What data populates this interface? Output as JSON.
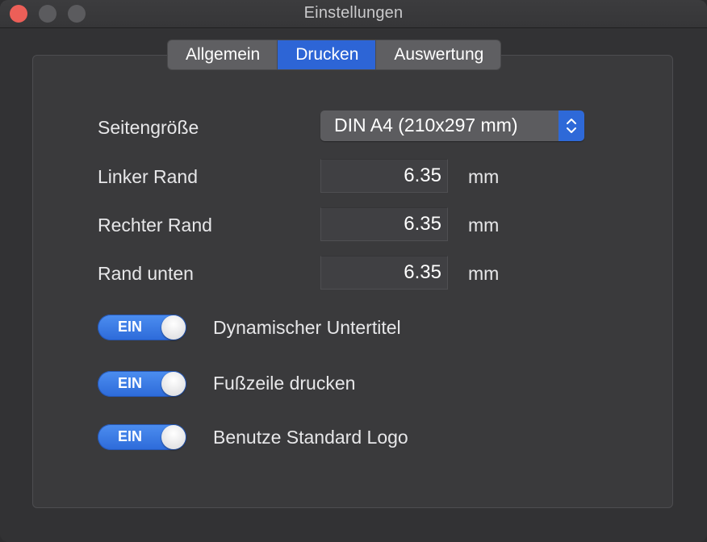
{
  "window": {
    "title": "Einstellungen"
  },
  "tabs": [
    {
      "label": "Allgemein",
      "active": false
    },
    {
      "label": "Drucken",
      "active": true
    },
    {
      "label": "Auswertung",
      "active": false
    }
  ],
  "page_size": {
    "label": "Seitengröße",
    "value": "DIN A4 (210x297 mm)"
  },
  "margins": [
    {
      "label": "Linker Rand",
      "value": "6.35",
      "unit": "mm"
    },
    {
      "label": "Rechter Rand",
      "value": "6.35",
      "unit": "mm"
    },
    {
      "label": "Rand unten",
      "value": "6.35",
      "unit": "mm"
    }
  ],
  "toggles": [
    {
      "state_label": "EIN",
      "label": "Dynamischer Untertitel",
      "on": true
    },
    {
      "state_label": "EIN",
      "label": "Fußzeile drucken",
      "on": true
    },
    {
      "state_label": "EIN",
      "label": "Benutze Standard Logo",
      "on": true
    }
  ],
  "colors": {
    "accent": "#2d65d6",
    "close": "#ec5f58"
  }
}
